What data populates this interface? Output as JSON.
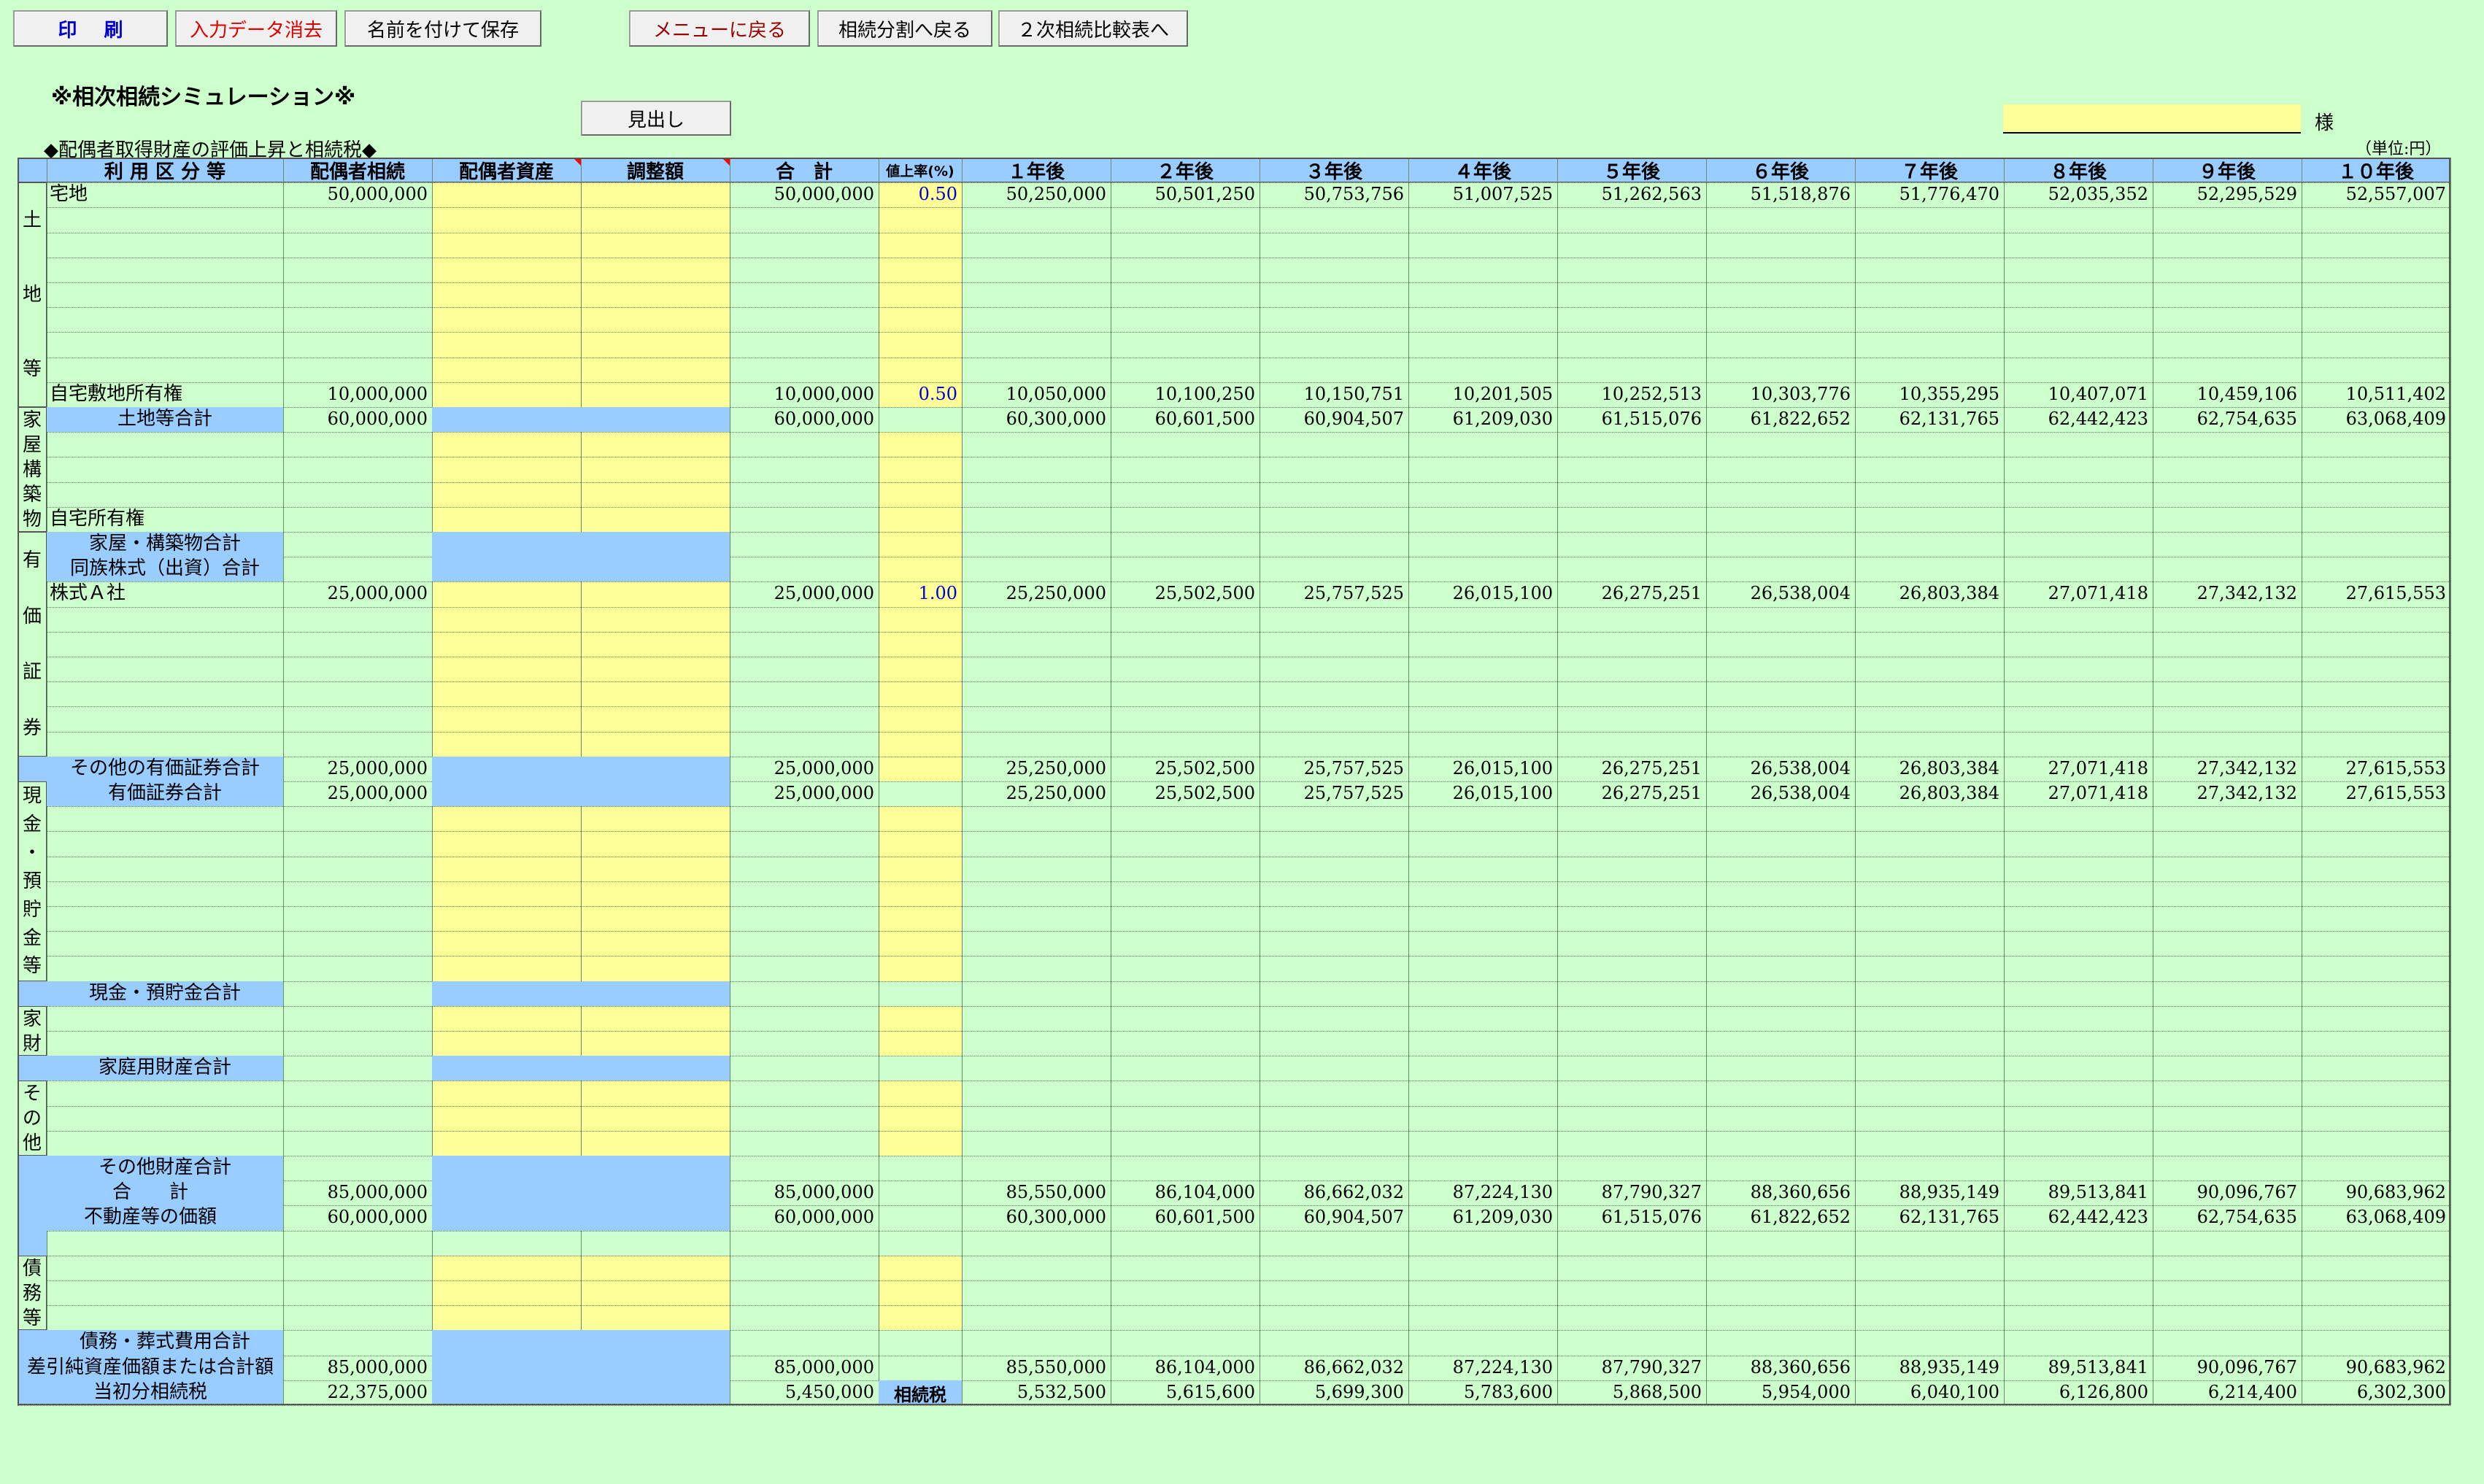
{
  "toolbar": {
    "print": "印 刷",
    "clear": "入力データ消去",
    "save_as": "名前を付けて保存",
    "menu": "メニューに戻る",
    "back_division": "相続分割へ戻る",
    "compare": "２次相続比較表へ"
  },
  "title": "※相次相続シミュレーション※",
  "midashi": "見出し",
  "subtitle": "◆配偶者取得財産の評価上昇と相続税◆",
  "name_suffix": "様",
  "unit": "（単位:円）",
  "columns": {
    "category": "利 用 区 分 等",
    "spouse_inherit": "配偶者相続",
    "spouse_assets": "配偶者資産",
    "adjust": "調整額",
    "total": "合　計",
    "rate": "値上率(%)",
    "years": [
      "１年後",
      "２年後",
      "３年後",
      "４年後",
      "５年後",
      "６年後",
      "７年後",
      "８年後",
      "９年後",
      "１０年後"
    ]
  },
  "sections": {
    "land": "土地等",
    "building": "家屋構築物",
    "securities": "有価証券",
    "cash": "現金・預貯金等",
    "household": "家財",
    "other": "その他",
    "debt": "債務等"
  },
  "rows": {
    "takuchi": {
      "label": "宅地",
      "spouse": "50,000,000",
      "total": "50,000,000",
      "rate": "0.50",
      "years": [
        "50,250,000",
        "50,501,250",
        "50,753,756",
        "51,007,525",
        "51,262,563",
        "51,518,876",
        "51,776,470",
        "52,035,352",
        "52,295,529",
        "52,557,007"
      ]
    },
    "shikichi": {
      "label": "自宅敷地所有権",
      "spouse": "10,000,000",
      "total": "10,000,000",
      "rate": "0.50",
      "years": [
        "10,050,000",
        "10,100,250",
        "10,150,751",
        "10,201,505",
        "10,252,513",
        "10,303,776",
        "10,355,295",
        "10,407,071",
        "10,459,106",
        "10,511,402"
      ]
    },
    "land_total": {
      "label": "土地等合計",
      "spouse": "60,000,000",
      "total": "60,000,000",
      "years": [
        "60,300,000",
        "60,601,500",
        "60,904,507",
        "61,209,030",
        "61,515,076",
        "61,822,652",
        "62,131,765",
        "62,442,423",
        "62,754,635",
        "63,068,409"
      ]
    },
    "jitaku": {
      "label": "自宅所有権"
    },
    "building_total": {
      "label": "家屋・構築物合計"
    },
    "dozoku": {
      "label": "同族株式（出資）合計"
    },
    "kabu_a": {
      "label": "株式Ａ社",
      "spouse": "25,000,000",
      "total": "25,000,000",
      "rate": "1.00",
      "years": [
        "25,250,000",
        "25,502,500",
        "25,757,525",
        "26,015,100",
        "26,275,251",
        "26,538,004",
        "26,803,384",
        "27,071,418",
        "27,342,132",
        "27,615,553"
      ]
    },
    "other_sec_total": {
      "label": "その他の有価証券合計",
      "spouse": "25,000,000",
      "total": "25,000,000",
      "years": [
        "25,250,000",
        "25,502,500",
        "25,757,525",
        "26,015,100",
        "26,275,251",
        "26,538,004",
        "26,803,384",
        "27,071,418",
        "27,342,132",
        "27,615,553"
      ]
    },
    "sec_total": {
      "label": "有価証券合計",
      "spouse": "25,000,000",
      "total": "25,000,000",
      "years": [
        "25,250,000",
        "25,502,500",
        "25,757,525",
        "26,015,100",
        "26,275,251",
        "26,538,004",
        "26,803,384",
        "27,071,418",
        "27,342,132",
        "27,615,553"
      ]
    },
    "cash_total": {
      "label": "現金・預貯金合計"
    },
    "household_total": {
      "label": "家庭用財産合計"
    },
    "other_total": {
      "label": "その他財産合計"
    },
    "grand_total": {
      "label": "合　　計",
      "spouse": "85,000,000",
      "total": "85,000,000",
      "years": [
        "85,550,000",
        "86,104,000",
        "86,662,032",
        "87,224,130",
        "87,790,327",
        "88,360,656",
        "88,935,149",
        "89,513,841",
        "90,096,767",
        "90,683,962"
      ]
    },
    "realestate": {
      "label": "不動産等の価額",
      "spouse": "60,000,000",
      "total": "60,000,000",
      "years": [
        "60,300,000",
        "60,601,500",
        "60,904,507",
        "61,209,030",
        "61,515,076",
        "61,822,652",
        "62,131,765",
        "62,442,423",
        "62,754,635",
        "63,068,409"
      ]
    },
    "debt_total": {
      "label": "債務・葬式費用合計"
    },
    "net": {
      "label": "差引純資産価額または合計額",
      "spouse": "85,000,000",
      "total": "85,000,000",
      "years": [
        "85,550,000",
        "86,104,000",
        "86,662,032",
        "87,224,130",
        "87,790,327",
        "88,360,656",
        "88,935,149",
        "89,513,841",
        "90,096,767",
        "90,683,962"
      ]
    },
    "tax": {
      "label": "当初分相続税",
      "spouse": "22,375,000",
      "total": "5,450,000",
      "tag": "相続税",
      "years": [
        "5,532,500",
        "5,615,600",
        "5,699,300",
        "5,783,600",
        "5,868,500",
        "5,954,000",
        "6,040,100",
        "6,126,800",
        "6,214,400",
        "6,302,300"
      ]
    }
  }
}
